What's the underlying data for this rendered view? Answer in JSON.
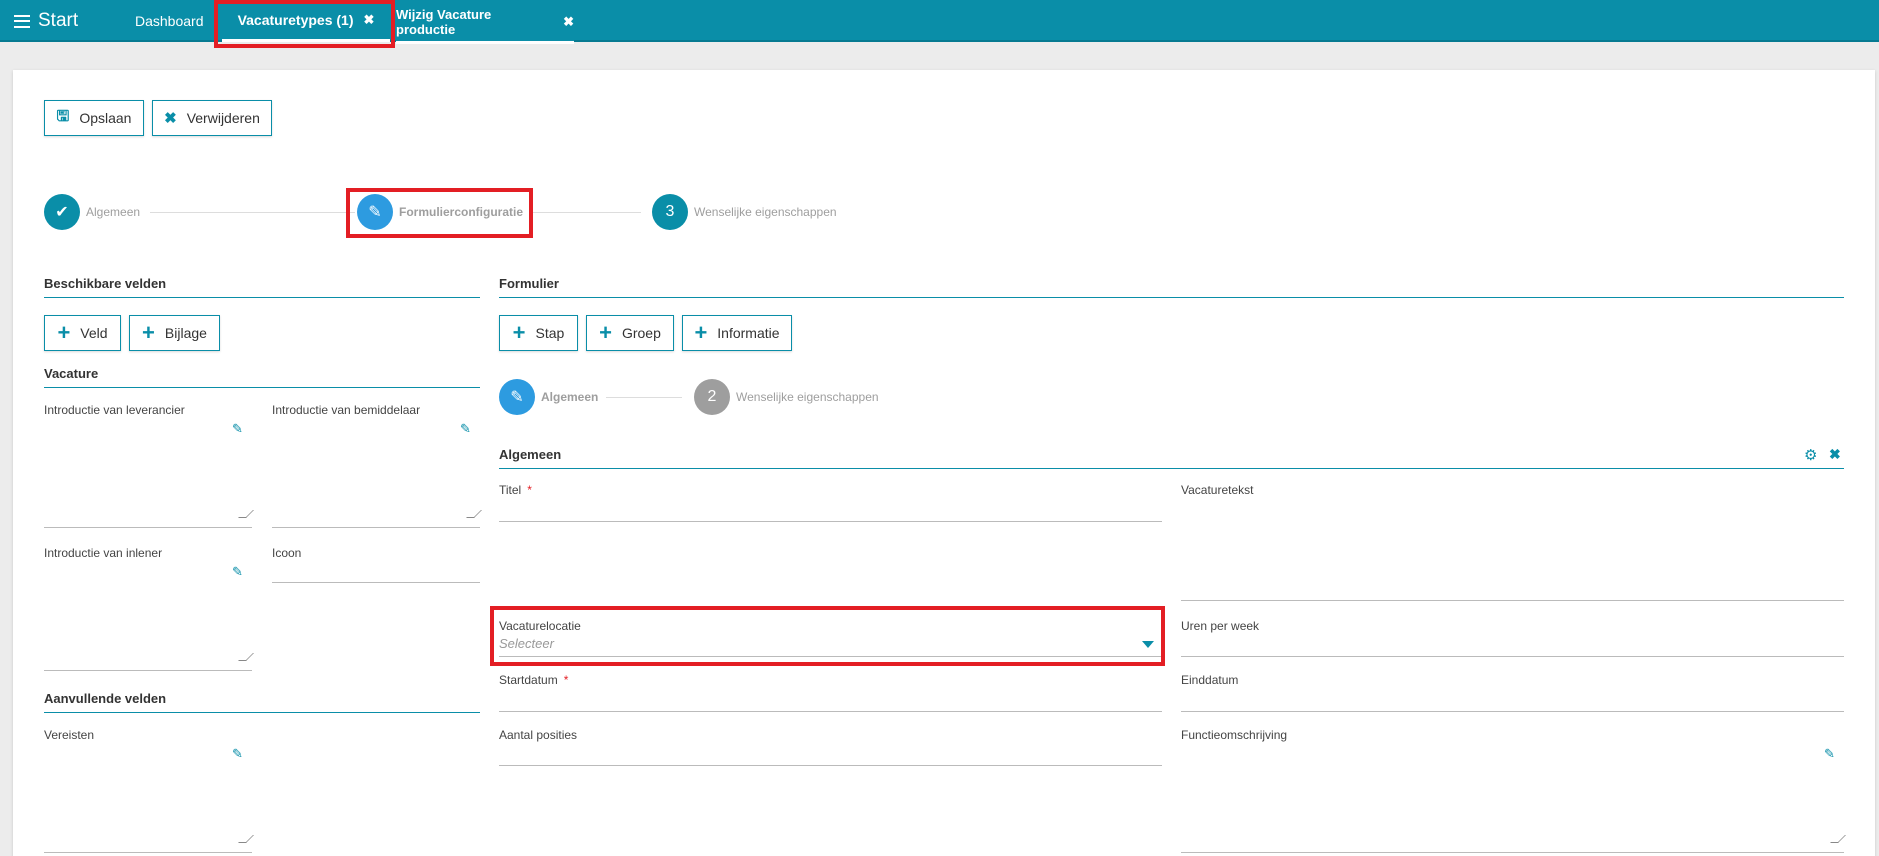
{
  "topbar": {
    "menu_label": "Start",
    "tabs": [
      {
        "label": "Dashboard"
      },
      {
        "label": "Vacaturetypes (1)"
      },
      {
        "label": "Wijzig Vacature productie"
      }
    ]
  },
  "toolbar": {
    "save_label": "Opslaan",
    "delete_label": "Verwijderen"
  },
  "wizard": {
    "steps": [
      {
        "label": "Algemeen",
        "icon": "check-icon"
      },
      {
        "label": "Formulierconfiguratie",
        "icon": "pencil-icon"
      },
      {
        "label": "Wenselijke eigenschappen",
        "number": "3"
      }
    ]
  },
  "available_fields": {
    "title": "Beschikbare velden",
    "buttons": [
      "Veld",
      "Bijlage"
    ],
    "vacature": {
      "title": "Vacature",
      "fields": [
        "Introductie van leverancier",
        "Introductie van bemiddelaar",
        "Introductie van inlener",
        "Icoon"
      ]
    },
    "extra": {
      "title": "Aanvullende velden",
      "fields": [
        "Vereisten"
      ]
    }
  },
  "form": {
    "title": "Formulier",
    "buttons": [
      "Stap",
      "Groep",
      "Informatie"
    ],
    "steps": [
      {
        "label": "Algemeen"
      },
      {
        "label": "Wenselijke eigenschappen",
        "number": "2"
      }
    ],
    "group_title": "Algemeen",
    "fields": {
      "titel": "Titel",
      "vacaturetekst": "Vacaturetekst",
      "vacaturelocatie": "Vacaturelocatie",
      "vacaturelocatie_placeholder": "Selecteer",
      "uren": "Uren per week",
      "startdatum": "Startdatum",
      "einddatum": "Einddatum",
      "aantal": "Aantal posities",
      "functie": "Functieomschrijving"
    },
    "required_mark": "*"
  }
}
